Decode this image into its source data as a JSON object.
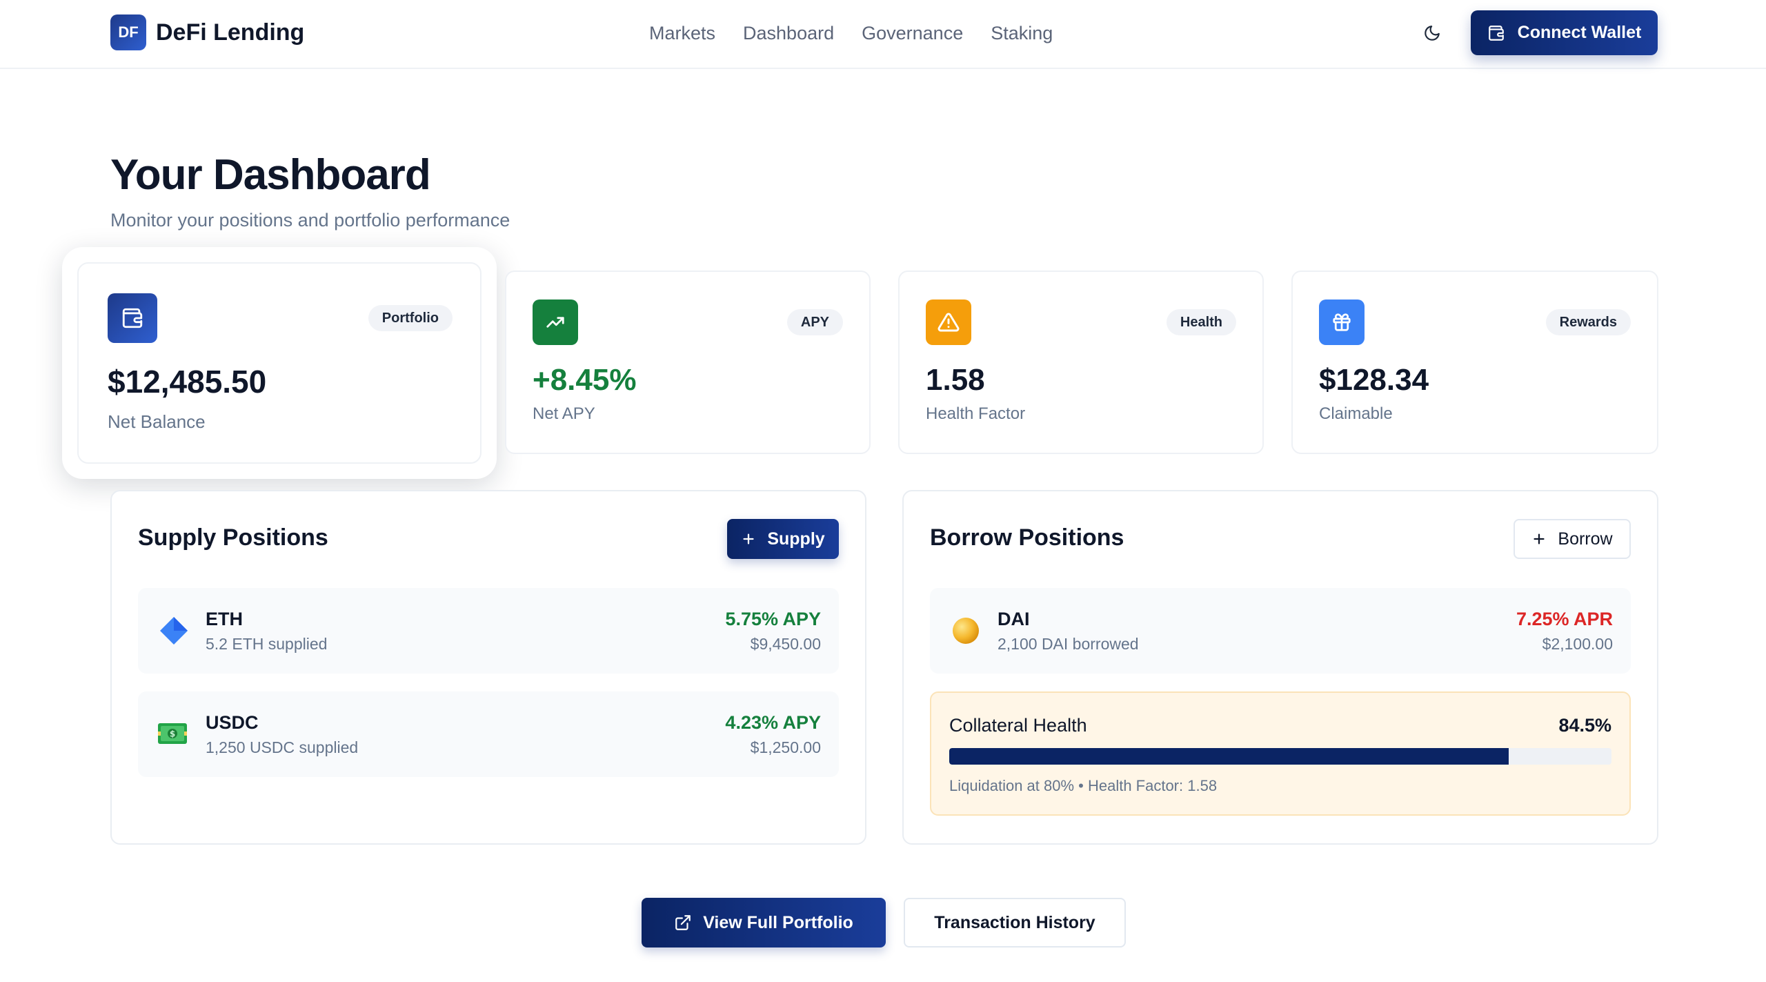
{
  "header": {
    "logo_badge": "DF",
    "brand": "DeFi Lending",
    "nav": [
      "Markets",
      "Dashboard",
      "Governance",
      "Staking"
    ],
    "theme_icon": "moon-icon",
    "connect_label": "Connect Wallet"
  },
  "page": {
    "title": "Your Dashboard",
    "subtitle": "Monitor your positions and portfolio performance"
  },
  "stats": [
    {
      "badge": "Portfolio",
      "value": "$12,485.50",
      "label": "Net Balance",
      "icon": "wallet-icon",
      "icon_color": "#1e3a8a"
    },
    {
      "badge": "APY",
      "value": "+8.45%",
      "label": "Net APY",
      "icon": "trending-up-icon",
      "icon_color": "#15803d",
      "value_color": "#15803d"
    },
    {
      "badge": "Health",
      "value": "1.58",
      "label": "Health Factor",
      "icon": "warning-icon",
      "icon_color": "#f59e0b"
    },
    {
      "badge": "Rewards",
      "value": "$128.34",
      "label": "Claimable",
      "icon": "gift-icon",
      "icon_color": "#3b82f6"
    }
  ],
  "supply": {
    "title": "Supply Positions",
    "button": "Supply",
    "positions": [
      {
        "symbol": "ETH",
        "sub": "5.2 ETH supplied",
        "rate": "5.75% APY",
        "amount": "$9,450.00",
        "icon": "diamond-icon"
      },
      {
        "symbol": "USDC",
        "sub": "1,250 USDC supplied",
        "rate": "4.23% APY",
        "amount": "$1,250.00",
        "icon": "banknote-icon"
      }
    ]
  },
  "borrow": {
    "title": "Borrow Positions",
    "button": "Borrow",
    "positions": [
      {
        "symbol": "DAI",
        "sub": "2,100 DAI borrowed",
        "rate": "7.25% APR",
        "amount": "$2,100.00",
        "icon": "coin-icon"
      }
    ],
    "collateral": {
      "title": "Collateral Health",
      "value": "84.5%",
      "progress": 0.845,
      "note": "Liquidation at 80% • Health Factor: 1.58"
    }
  },
  "footer": {
    "primary": "View Full Portfolio",
    "secondary": "Transaction History"
  },
  "colors": {
    "primary": "#0b2464",
    "accent_green": "#15803d",
    "accent_red": "#dc2626",
    "warning": "#f59e0b",
    "info": "#3b82f6"
  }
}
